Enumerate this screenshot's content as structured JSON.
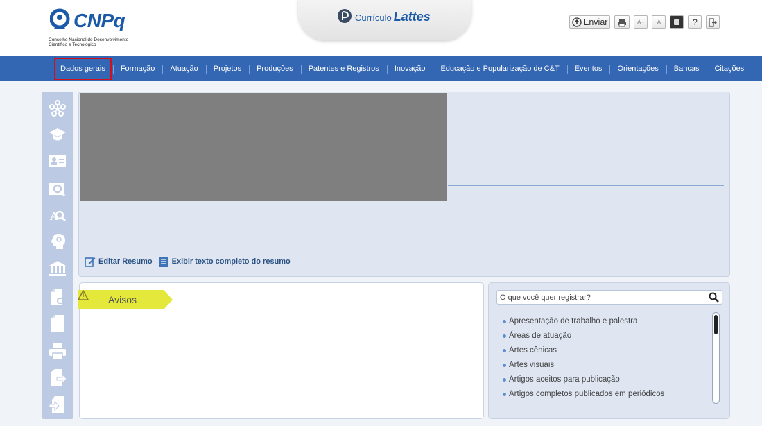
{
  "header": {
    "logo_text": "CNPq",
    "logo_subtitle": "Conselho Nacional de Desenvolvimento Científico e Tecnológico",
    "app_title_prefix": "Currículo",
    "app_title_main": "Lattes",
    "toolbar": {
      "enviar_label": "Enviar",
      "font_increase_label": "A+",
      "font_normal_label": "A",
      "help_label": "?"
    }
  },
  "nav": {
    "items": [
      {
        "label": "Dados gerais"
      },
      {
        "label": "Formação"
      },
      {
        "label": "Atuação"
      },
      {
        "label": "Projetos"
      },
      {
        "label": "Produções"
      },
      {
        "label": "Patentes e Registros"
      },
      {
        "label": "Inovação"
      },
      {
        "label": "Educação e Popularização de C&T"
      },
      {
        "label": "Eventos"
      },
      {
        "label": "Orientações"
      },
      {
        "label": "Bancas"
      },
      {
        "label": "Citações"
      }
    ],
    "active_index": 0
  },
  "sidebar": {
    "icons": [
      "network-icon",
      "graduation-icon",
      "id-card-icon",
      "search-profile-icon",
      "search-text-icon",
      "head-icon",
      "institution-icon",
      "document-link-icon",
      "document-icon",
      "print-icon",
      "export-icon",
      "import-icon"
    ]
  },
  "profile": {
    "edit_resumo_label": "Editar Resumo",
    "full_resumo_label": "Exibir texto completo do resumo"
  },
  "avisos": {
    "label": "Avisos"
  },
  "register": {
    "search_placeholder": "O que você quer registrar?",
    "items": [
      "Apresentação de trabalho e palestra",
      "Áreas de atuação",
      "Artes cênicas",
      "Artes visuais",
      "Artigos aceitos para publicação",
      "Artigos completos publicados em periódicos"
    ]
  },
  "colors": {
    "nav_bg": "#3366b3",
    "active_outline": "#d0111b",
    "brand_blue": "#1b5aa8",
    "avisos_tag": "#e3e83a"
  }
}
